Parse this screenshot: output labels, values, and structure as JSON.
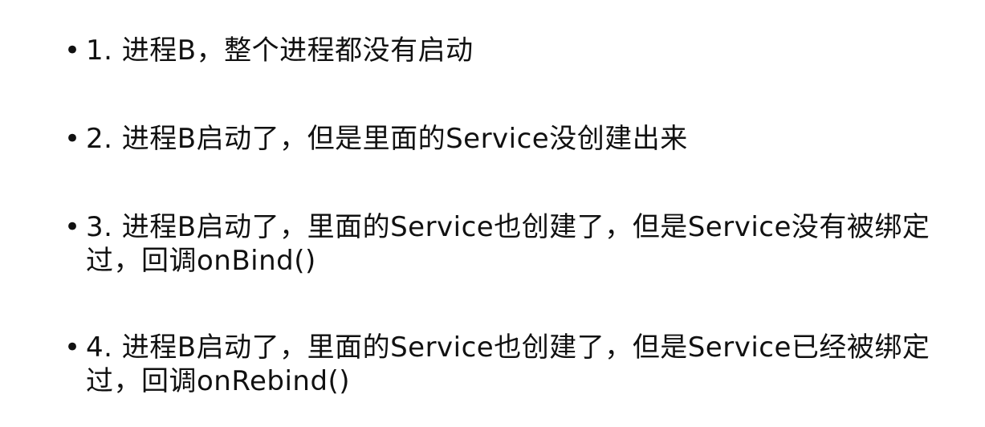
{
  "bullet_symbol": "•",
  "items": [
    {
      "text": "1. 进程B，整个进程都没有启动"
    },
    {
      "text": "2. 进程B启动了，但是里面的Service没创建出来"
    },
    {
      "text": "3. 进程B启动了，里面的Service也创建了，但是Service没有被绑定过，回调onBind()"
    },
    {
      "text": "4. 进程B启动了，里面的Service也创建了，但是Service已经被绑定过，回调onRebind()"
    }
  ]
}
